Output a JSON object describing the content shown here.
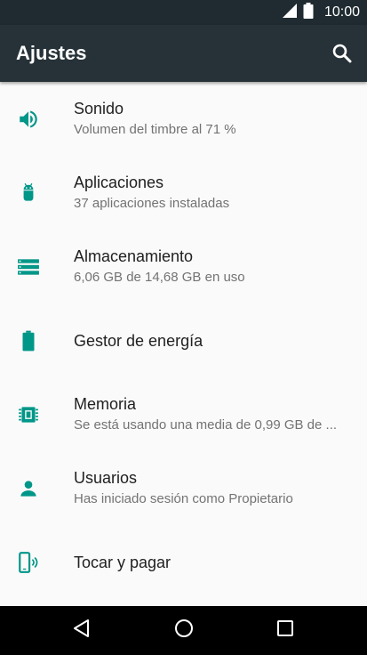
{
  "status_bar": {
    "time": "10:00"
  },
  "app_bar": {
    "title": "Ajustes",
    "search_icon": "search-icon"
  },
  "colors": {
    "accent": "#009688",
    "app_bar": "#263238",
    "status_bar": "#1f2b31",
    "title_text": "#212121",
    "summary_text": "#737373"
  },
  "items": [
    {
      "icon": "volume-icon",
      "title": "Sonido",
      "summary": "Volumen del timbre al 71 %"
    },
    {
      "icon": "android-icon",
      "title": "Aplicaciones",
      "summary": "37 aplicaciones instaladas"
    },
    {
      "icon": "storage-icon",
      "title": "Almacenamiento",
      "summary": "6,06 GB de 14,68 GB en uso"
    },
    {
      "icon": "battery-icon",
      "title": "Gestor de energía",
      "summary": ""
    },
    {
      "icon": "memory-icon",
      "title": "Memoria",
      "summary": "Se está usando una media de 0,99 GB de ..."
    },
    {
      "icon": "person-icon",
      "title": "Usuarios",
      "summary": "Has iniciado sesión como Propietario"
    },
    {
      "icon": "tap-and-pay-icon",
      "title": "Tocar y pagar",
      "summary": ""
    }
  ],
  "nav_bar": {
    "back_icon": "back-icon",
    "home_icon": "home-icon",
    "recents_icon": "recents-icon"
  }
}
